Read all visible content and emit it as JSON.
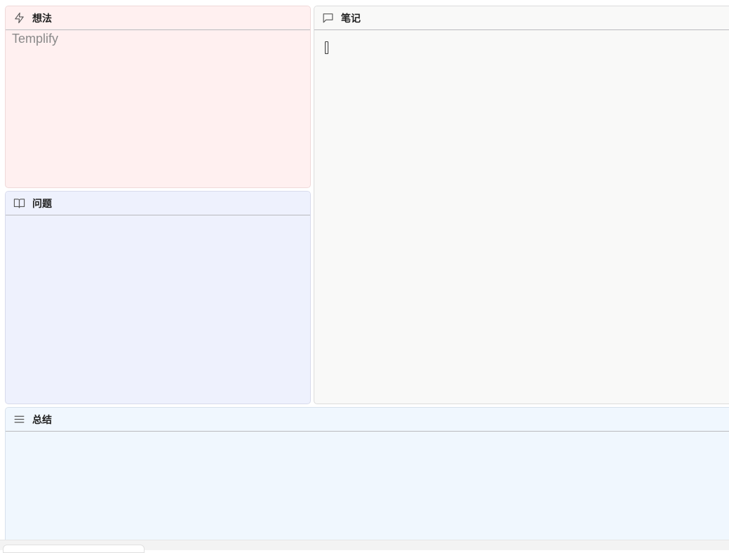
{
  "colors": {
    "ideas_bg": "#fff0f0",
    "questions_bg": "#eef1fd",
    "notes_bg": "#f9f9f8",
    "summary_bg": "#f0f7fe"
  },
  "panels": {
    "ideas": {
      "title": "想法",
      "icon": "lightning-icon",
      "placeholder": "Templify"
    },
    "notes": {
      "title": "笔记",
      "icon": "comment-icon"
    },
    "questions": {
      "title": "问题",
      "icon": "book-icon"
    },
    "summary": {
      "title": "总结",
      "icon": "menu-lines-icon"
    }
  }
}
